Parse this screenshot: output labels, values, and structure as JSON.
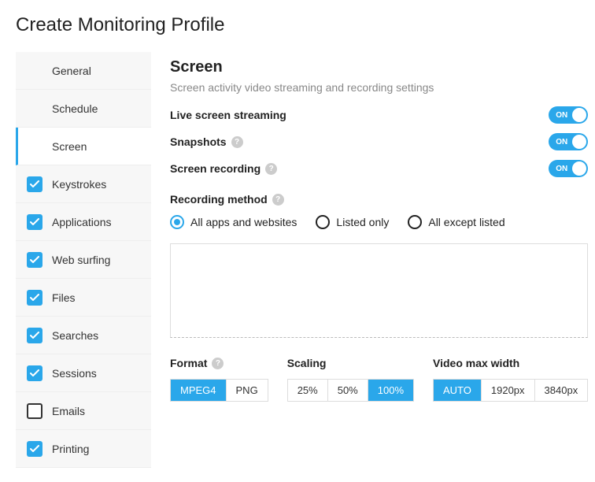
{
  "page_title": "Create Monitoring Profile",
  "sidebar": {
    "items": [
      {
        "label": "General",
        "checkbox": "none",
        "active": false
      },
      {
        "label": "Schedule",
        "checkbox": "none",
        "active": false
      },
      {
        "label": "Screen",
        "checkbox": "none",
        "active": true
      },
      {
        "label": "Keystrokes",
        "checkbox": "on",
        "active": false
      },
      {
        "label": "Applications",
        "checkbox": "on",
        "active": false
      },
      {
        "label": "Web surfing",
        "checkbox": "on",
        "active": false
      },
      {
        "label": "Files",
        "checkbox": "on",
        "active": false
      },
      {
        "label": "Searches",
        "checkbox": "on",
        "active": false
      },
      {
        "label": "Sessions",
        "checkbox": "on",
        "active": false
      },
      {
        "label": "Emails",
        "checkbox": "off",
        "active": false
      },
      {
        "label": "Printing",
        "checkbox": "on",
        "active": false
      }
    ]
  },
  "content": {
    "heading": "Screen",
    "subtitle": "Screen activity video streaming and recording settings",
    "toggles": [
      {
        "label": "Live screen streaming",
        "help": false,
        "state": "ON"
      },
      {
        "label": "Snapshots",
        "help": true,
        "state": "ON"
      },
      {
        "label": "Screen recording",
        "help": true,
        "state": "ON"
      }
    ],
    "recording_method": {
      "label": "Recording method",
      "options": [
        {
          "label": "All apps and websites",
          "selected": true
        },
        {
          "label": "Listed only",
          "selected": false
        },
        {
          "label": "All except listed",
          "selected": false
        }
      ]
    },
    "textarea_value": "",
    "format": {
      "label": "Format",
      "options": [
        {
          "label": "MPEG4",
          "active": true
        },
        {
          "label": "PNG",
          "active": false
        }
      ]
    },
    "scaling": {
      "label": "Scaling",
      "options": [
        {
          "label": "25%",
          "active": false
        },
        {
          "label": "50%",
          "active": false
        },
        {
          "label": "100%",
          "active": true
        }
      ]
    },
    "video_max_width": {
      "label": "Video max width",
      "options": [
        {
          "label": "AUTO",
          "active": true
        },
        {
          "label": "1920px",
          "active": false
        },
        {
          "label": "3840px",
          "active": false
        }
      ]
    }
  }
}
